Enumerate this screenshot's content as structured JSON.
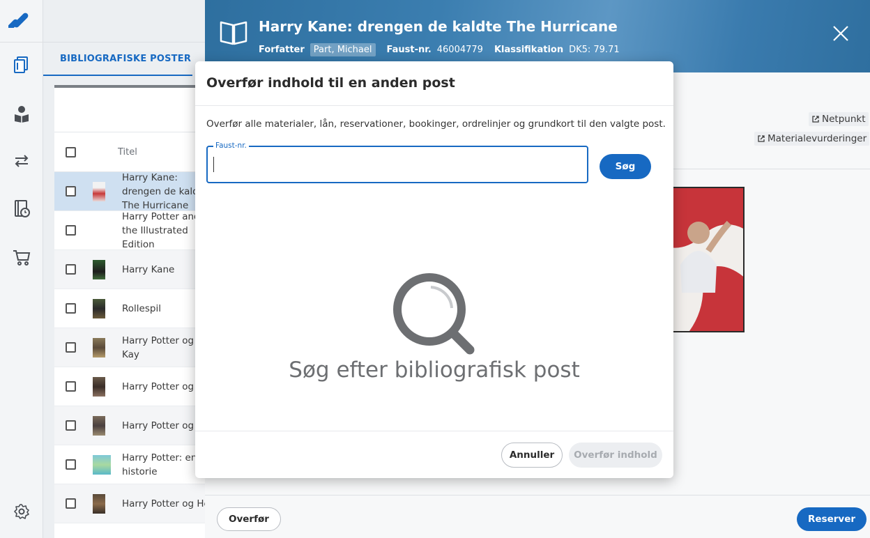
{
  "rail": {
    "icons": [
      "logo-icon",
      "catalog-icon",
      "patron-icon",
      "transfer-icon",
      "reservations-icon",
      "cart-icon",
      "settings-icon"
    ]
  },
  "list": {
    "tab_label": "BIBLIOGRAFISKE POSTER",
    "column_title": "Titel",
    "rows": [
      {
        "title": "Harry Kane: drengen de kaldte The Hurricane",
        "selected": true
      },
      {
        "title": "Harry Potter and the Illustrated Edition"
      },
      {
        "title": "Harry Kane"
      },
      {
        "title": "Rollespil"
      },
      {
        "title": "Harry Potter og Kay"
      },
      {
        "title": "Harry Potter og"
      },
      {
        "title": "Harry Potter og"
      },
      {
        "title": "Harry Potter: en historie"
      },
      {
        "title": "Harry Potter og He"
      }
    ]
  },
  "detail": {
    "title": "Harry Kane: drengen de kaldte The Hurricane",
    "author_label": "Forfatter",
    "author": "Part, Michael",
    "faust_label": "Faust-nr.",
    "faust": "46004779",
    "class_label": "Klassifikation",
    "class": "DK5: 79.71",
    "link_netpunkt": "Netpunkt",
    "link_reviews": "Materialevurderinger",
    "btn_transfer": "Overfør",
    "btn_reserve": "Reserver"
  },
  "modal": {
    "title": "Overfør indhold til en anden post",
    "description": "Overfør alle materialer, lån, reservationer, bookinger, ordrelinjer og grundkort til den valgte post.",
    "field_label": "Faust-nr.",
    "field_value": "",
    "search_btn": "Søg",
    "empty_text": "Søg efter bibliografisk post",
    "cancel_btn": "Annuller",
    "transfer_btn": "Overfør indhold"
  },
  "colors": {
    "primary": "#1769c2",
    "hero": "#3b7eb0",
    "disabled_bg": "#eceef1",
    "disabled_text": "#a7abb0"
  }
}
